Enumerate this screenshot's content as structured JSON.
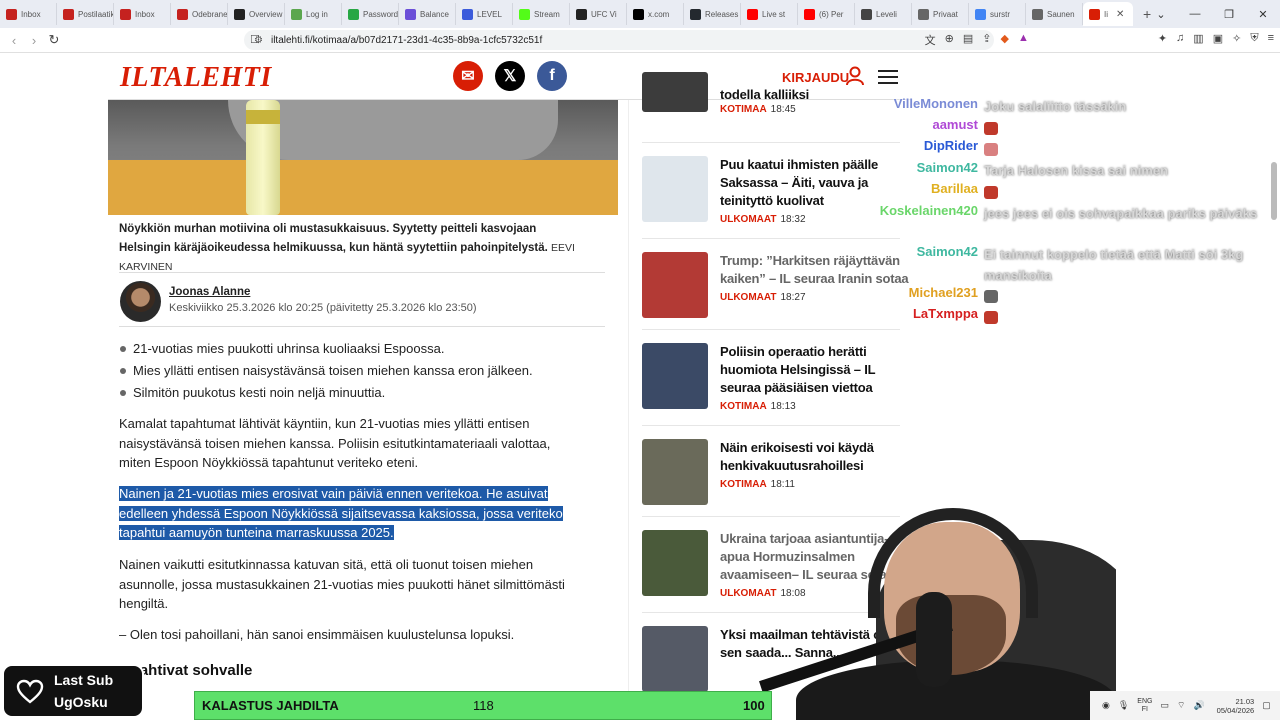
{
  "browser": {
    "tabs": [
      {
        "label": "Inbox",
        "color": "#c5221f"
      },
      {
        "label": "Postilaatikko",
        "color": "#c5221f"
      },
      {
        "label": "Inbox",
        "color": "#c5221f"
      },
      {
        "label": "Odebrane",
        "color": "#c5221f"
      },
      {
        "label": "Overview",
        "color": "#222222"
      },
      {
        "label": "Log in",
        "color": "#5ba64e"
      },
      {
        "label": "Passwords",
        "color": "#27a744"
      },
      {
        "label": "Balance",
        "color": "#6b4fd8"
      },
      {
        "label": "LEVEL",
        "color": "#3b5bdb"
      },
      {
        "label": "Stream",
        "color": "#53fc18"
      },
      {
        "label": "UFC Vi",
        "color": "#222222"
      },
      {
        "label": "x.com",
        "color": "#000000"
      },
      {
        "label": "Releases",
        "color": "#24292f"
      },
      {
        "label": "Live st",
        "color": "#ff0000"
      },
      {
        "label": "(6) Per",
        "color": "#ff0000"
      },
      {
        "label": "Leveli",
        "color": "#444444"
      },
      {
        "label": "Privaat",
        "color": "#666666"
      },
      {
        "label": "surstr",
        "color": "#4285f4"
      },
      {
        "label": "Saunen",
        "color": "#666666"
      },
      {
        "label": "Ii",
        "color": "#d81e05"
      }
    ],
    "url": "iltalehti.fi/kotimaa/a/b07d2171-23d1-4c35-8b9a-1cfc5732c51f"
  },
  "site": {
    "logo": "ILTALEHTI",
    "login_label": "KIRJAUDU"
  },
  "article": {
    "caption": "Nöykkiön murhan motiivina oli mustasukkaisuus. Syytetty peitteli kasvojaan Helsingin käräjäoikeudessa helmikuussa, kun häntä syytettiin pahoinpitelystä.",
    "caption_credit": "EEVI KARVINEN",
    "author": "Joonas Alanne",
    "date": "Keskiviikko 25.3.2026 klo 20:25 (päivitetty 25.3.2026 klo 23:50)",
    "bullets": [
      "21-vuotias mies puukotti uhrinsa kuoliaaksi Espoossa.",
      "Mies yllätti entisen naisystävänsä toisen miehen kanssa eron jälkeen.",
      "Silmitön puukotus kesti noin neljä minuuttia."
    ],
    "para1": "Kamalat tapahtumat lähtivät käyntiin, kun 21-vuotias mies yllätti entisen naisystävänsä toisen miehen kanssa. Poliisin esitutkintamateriaali valottaa, miten Espoon Nöykkiössä tapahtunut veriteko eteni.",
    "para2": "Nainen ja 21-vuotias mies erosivat vain päiviä ennen veritekoa. He asuivat edelleen yhdessä Espoon Nöykkiössä sijaitsevassa kaksiossa, jossa veriteko tapahtui aamuyön tunteina marraskuussa 2025.",
    "para3": "Nainen vaikutti esitutkinnassa katuvan sitä, että oli tuonut toisen miehen asunnolle, jossa mustasukkainen 21-vuotias mies puukotti hänet silmittömästi hengiltä.",
    "para4": "– Olen tosi pahoillani, hän sanoi ensimmäisen kuulustelunsa lopuksi.",
    "subhead": "...kahtivat sohvalle"
  },
  "sidebar": {
    "news": [
      {
        "title": "todella kalliiksi",
        "section": "KOTIMAA",
        "time": "18:45",
        "thumb": "#3c3c3c",
        "gray": false
      },
      {
        "title": "Puu kaatui ihmisten päälle Saksassa – Äiti, vauva ja teinityttö kuolivat",
        "section": "ULKOMAAT",
        "time": "18:32",
        "thumb": "#dfe6ec",
        "gray": false
      },
      {
        "title": "Trump: ”Harkitsen räjäyttävän kaiken” – IL seuraa Iranin sotaa",
        "section": "ULKOMAAT",
        "time": "18:27",
        "thumb": "#b33a35",
        "gray": true
      },
      {
        "title": "Poliisin operaatio herätti huomiota Helsingissä – IL seuraa pääsiäisen viettoa",
        "section": "KOTIMAA",
        "time": "18:13",
        "thumb": "#3b4a66",
        "gray": false
      },
      {
        "title": "Näin erikoisesti voi käydä henkivakuutusrahoillesi",
        "section": "KOTIMAA",
        "time": "18:11",
        "thumb": "#6a6a5a",
        "gray": false
      },
      {
        "title": "Ukraina tarjoaa asiantuntija-apua Hormuzinsalmen avaamiseen– IL seuraa sotaa",
        "section": "ULKOMAAT",
        "time": "18:08",
        "thumb": "#4a5a3a",
        "gray": true
      },
      {
        "title": "Yksi maailman tehtävistä o... sen saada... Sanna...",
        "section": "",
        "time": "",
        "thumb": "#555a66",
        "gray": false
      }
    ]
  },
  "chat": [
    {
      "user": "VilleMononen",
      "color": "#7a8bd6",
      "msg": "Joku salaliitto tässäkin"
    },
    {
      "user": "aamust",
      "color": "#b04ad6",
      "msg": ""
    },
    {
      "user": "DipRider",
      "color": "#2a5ad6",
      "msg": ""
    },
    {
      "user": "Saimon42",
      "color": "#3fb8a0",
      "msg": "Tarja Halosen kissa sai nimen"
    },
    {
      "user": "Barillaa",
      "color": "#e0b020",
      "msg": ""
    },
    {
      "user": "Koskelainen420",
      "color": "#6ad66a",
      "msg": "jees jees ei ois sohvapaikkaa pariks päiväks"
    },
    {
      "user": "Saimon42",
      "color": "#3fb8a0",
      "msg": "Ei tainnut koppelo tietää että Matti söi 3kg mansikoita"
    },
    {
      "user": "Michael231",
      "color": "#e0a020",
      "msg": ""
    },
    {
      "user": "LaTxmppa",
      "color": "#d62020",
      "msg": ""
    }
  ],
  "overlay": {
    "sub_title": "Last Sub",
    "sub_name": "UgOsku",
    "goal_label": "KALASTUS JAHDILTA",
    "goal_current": "118",
    "goal_target": "100"
  },
  "taskbar": {
    "lang_top": "ENG",
    "lang_bottom": "FI",
    "time": "21.03",
    "date": "05/04/2026"
  }
}
